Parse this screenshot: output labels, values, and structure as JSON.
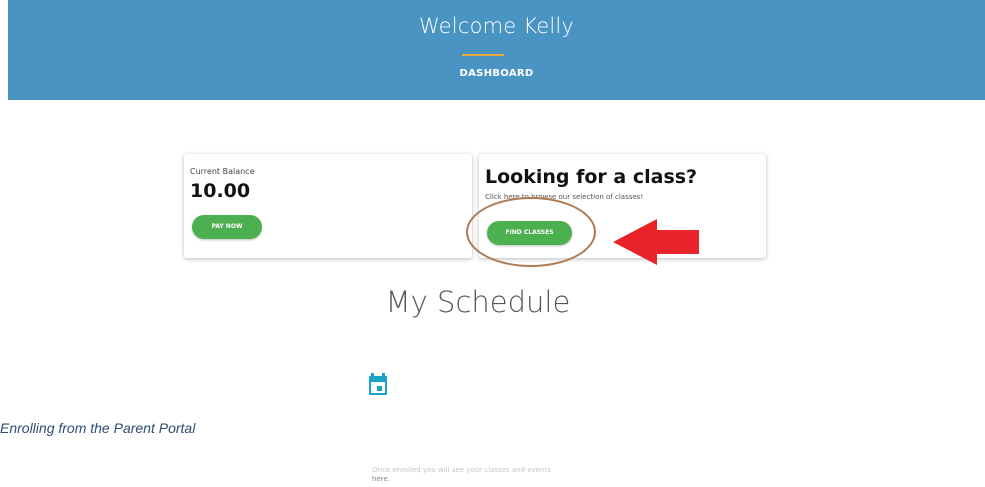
{
  "header": {
    "welcome": "Welcome Kelly",
    "dashboard_link": "DASHBOARD",
    "bg_color": "#4a94c4",
    "accent_color": "#e8a63b"
  },
  "balance_card": {
    "label": "Current Balance",
    "amount": "10.00",
    "pay_button": "PAY NOW"
  },
  "class_card": {
    "title": "Looking for a class?",
    "subtitle": "Click here to browse our selection of classes!",
    "find_button": "FIND CLASSES"
  },
  "schedule": {
    "title": "My Schedule",
    "empty_text_line1": "Once enrolled you will see your classes and events",
    "empty_text_line2": "here."
  },
  "caption": "Enrolling from the Parent Portal",
  "annotations": {
    "arrow_color": "#e8232a",
    "oval_color": "#b07a52",
    "button_color": "#4caf50",
    "calendar_icon": "calendar-icon",
    "calendar_color": "#1aa3c9"
  }
}
